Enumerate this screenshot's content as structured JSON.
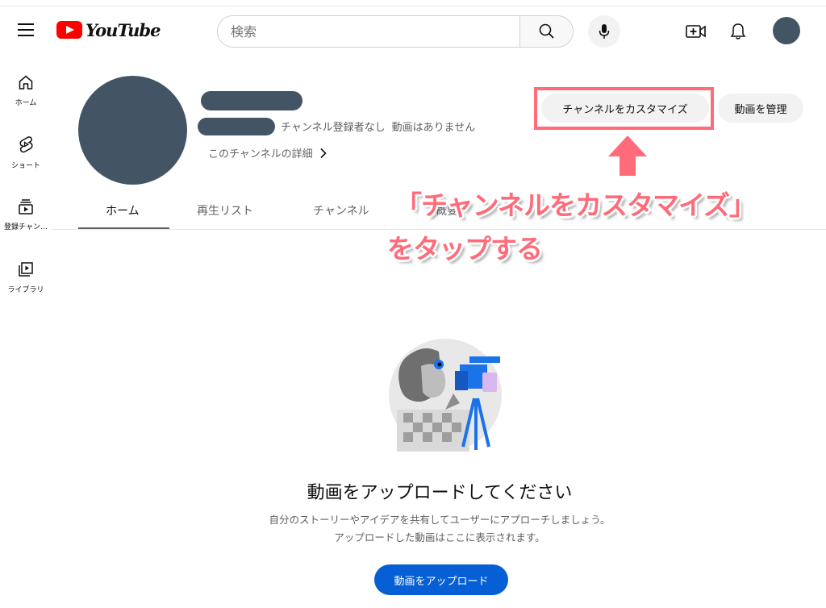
{
  "header": {
    "logo_text": "YouTube",
    "search_placeholder": "検索"
  },
  "sidebar": {
    "items": [
      {
        "label": "ホーム",
        "icon": "home-icon"
      },
      {
        "label": "ショート",
        "icon": "shorts-icon"
      },
      {
        "label": "登録チャン…",
        "icon": "subscriptions-icon"
      },
      {
        "label": "ライブラリ",
        "icon": "library-icon"
      }
    ]
  },
  "channel": {
    "subscribers": "チャンネル登録者なし",
    "videos": "動画はありません",
    "details_link": "このチャンネルの詳細",
    "customize_button": "チャンネルをカスタマイズ",
    "manage_button": "動画を管理"
  },
  "tabs": [
    {
      "label": "ホーム",
      "active": true
    },
    {
      "label": "再生リスト",
      "active": false
    },
    {
      "label": "チャンネル",
      "active": false
    },
    {
      "label": "概要",
      "active": false
    }
  ],
  "annotation": {
    "line1": "「チャンネルをカスタマイズ」",
    "line2": "をタップする",
    "color": "#ff6b78"
  },
  "empty_state": {
    "title": "動画をアップロードしてください",
    "desc_line1": "自分のストーリーやアイデアを共有してユーザーにアプローチしましょう。",
    "desc_line2": "アップロードした動画はここに表示されます。",
    "upload_button": "動画をアップロード"
  },
  "colors": {
    "brand_red": "#ff0000",
    "upload_blue": "#065fd4",
    "avatar": "#435564"
  }
}
